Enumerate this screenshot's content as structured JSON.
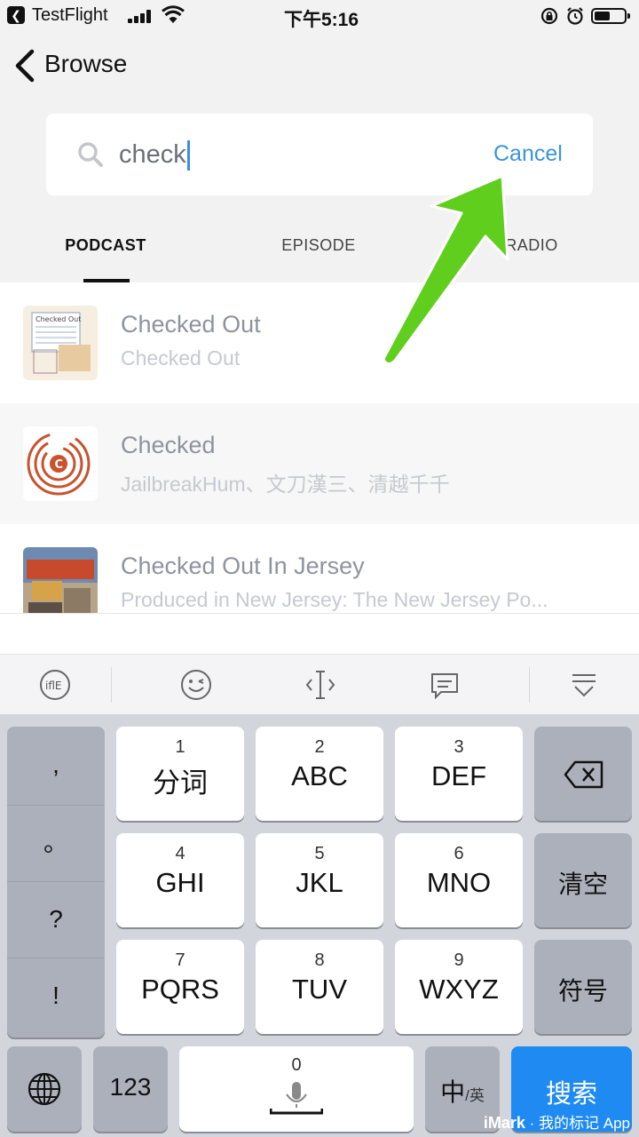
{
  "status_bar": {
    "back_app": "TestFlight",
    "time": "下午5:16"
  },
  "nav": {
    "title": "Browse"
  },
  "search": {
    "query": "check",
    "cancel_label": "Cancel"
  },
  "tabs": [
    {
      "label": "PODCAST",
      "active": true
    },
    {
      "label": "EPISODE",
      "active": false
    },
    {
      "label": "RADIO",
      "active": false
    }
  ],
  "results": [
    {
      "title": "Checked Out",
      "subtitle": "Checked Out"
    },
    {
      "title": "Checked",
      "subtitle": "JailbreakHum、文刀漢三、清越千千"
    },
    {
      "title": "Checked Out In Jersey",
      "subtitle": "Produced in New Jersey:  The New Jersey Po..."
    }
  ],
  "keyboard": {
    "punct": [
      ",",
      "。",
      "?",
      "!"
    ],
    "keys": [
      {
        "num": "1",
        "label": "分词"
      },
      {
        "num": "2",
        "label": "ABC"
      },
      {
        "num": "3",
        "label": "DEF"
      },
      {
        "num": "4",
        "label": "GHI"
      },
      {
        "num": "5",
        "label": "JKL"
      },
      {
        "num": "6",
        "label": "MNO"
      },
      {
        "num": "7",
        "label": "PQRS"
      },
      {
        "num": "8",
        "label": "TUV"
      },
      {
        "num": "9",
        "label": "WXYZ"
      }
    ],
    "clear_label": "清空",
    "symbols_label": "符号",
    "numbers_label": "123",
    "space_num": "0",
    "lang_label_main": "中",
    "lang_label_sub": "/英",
    "search_label": "搜索"
  },
  "watermark": {
    "brand": "iMark",
    "text": "· 我的标记 App"
  },
  "colors": {
    "accent": "#3a95d8",
    "arrow": "#5fce1d",
    "search_key": "#1e8af2"
  }
}
